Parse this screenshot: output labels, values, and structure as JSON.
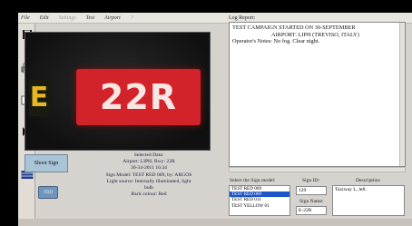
{
  "menu": [
    "File",
    "Edit",
    "Settings",
    "Test",
    "Airport",
    "?"
  ],
  "menu_dim": [
    false,
    false,
    true,
    false,
    false,
    true
  ],
  "toolbar_icons": [
    "save-icon",
    "print-icon",
    "copy-icon",
    "help-icon",
    "flag-icon"
  ],
  "camera": {
    "sign_letter": "E",
    "sign_text": "22R",
    "colors": {
      "sign_bg": "#d3232a",
      "letter": "#e3b823"
    }
  },
  "selected_data": {
    "title": "Selected Data:",
    "airport": "Airport: LIPH, Rwy: 22R",
    "datetime": "30-34-2011 10.34",
    "model": "Sign Model: TEST RED 009, by: ARGOS",
    "light": "Light source: Internally illuminated, light",
    "light2": "bulb",
    "back": "Back colour: Red"
  },
  "buttons": {
    "shoot": "Shoot Sign",
    "small": "TBD"
  },
  "log": {
    "label": "Log Report:",
    "lines": [
      "TEST CAMPAIGN STARTED ON 30-SEPTEMBER",
      "AIRPORT: LIPH (TREVISO, ITALY)",
      "Operator's Notes: No fog. Clear night."
    ]
  },
  "sign_model": {
    "label": "Select the Sign model:",
    "options": [
      "TEST RED 009",
      "TEST RED 009",
      "TEST RED 011",
      "TEST YELLOW 01"
    ],
    "selected_index": 1
  },
  "sign_id": {
    "label": "Sign ID:",
    "value": "129"
  },
  "sign_name": {
    "label": "Sign Name:",
    "value": "E-22R"
  },
  "description": {
    "label": "Description:",
    "value": "Taxiway L, left."
  }
}
